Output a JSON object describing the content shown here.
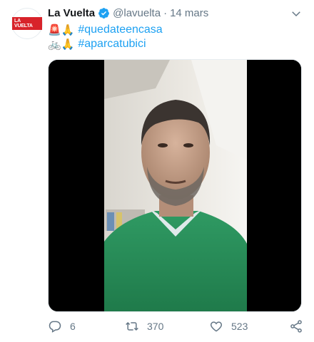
{
  "tweet": {
    "author": {
      "name": "La Vuelta",
      "handle": "@lavuelta",
      "separator": "·",
      "date": "14 mars",
      "avatar_text": "LA VUELTA"
    },
    "lines": [
      {
        "emojis": "🚨🙏",
        "hashtag": "#quedateencasa"
      },
      {
        "emojis": "🚲🙏",
        "hashtag": "#aparcatubici"
      }
    ],
    "stats": {
      "replies": "6",
      "retweets": "370",
      "likes": "523"
    },
    "colors": {
      "accent": "#1da1f2",
      "muted": "#657786",
      "brand_red": "#d8232a",
      "scrubs_green": "#2e8b57"
    },
    "icons": {
      "verified": "verified-badge-icon",
      "caret": "chevron-down-icon",
      "reply": "reply-icon",
      "retweet": "retweet-icon",
      "like": "heart-icon",
      "share": "share-icon"
    }
  }
}
